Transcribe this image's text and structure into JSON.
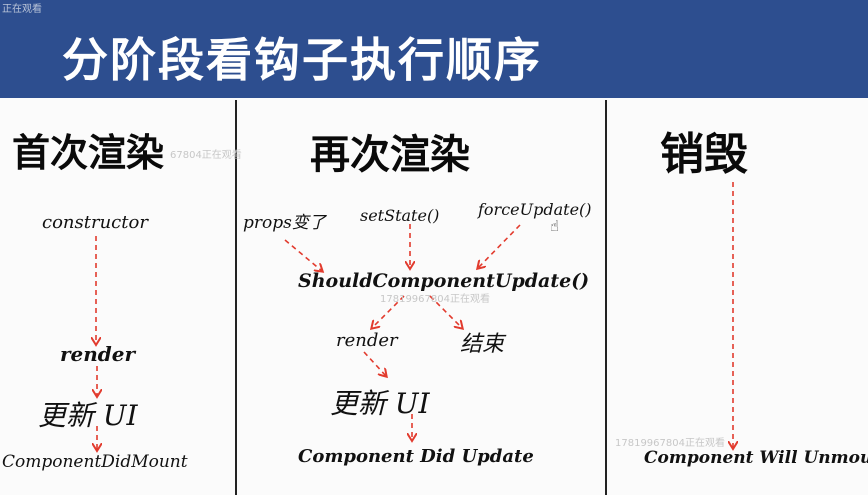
{
  "title": "分阶段看钩子执行顺序",
  "top_mark": "正在观看",
  "columns": {
    "first_render": {
      "heading": "首次渲染",
      "constructor": "constructor",
      "render": "render",
      "update_ui": "更新 UI",
      "did_mount": "ComponentDidMount"
    },
    "re_render": {
      "heading": "再次渲染",
      "props_change": "props变了",
      "set_state": "setState()",
      "force_update": "forceUpdate()",
      "should_update": "ShouldComponentUpdate()",
      "render": "render",
      "end": "结束",
      "update_ui": "更新 UI",
      "did_update": "Component Did Update"
    },
    "unmount": {
      "heading": "销毁",
      "will_unmount": "Component Will Unmount"
    }
  },
  "watermarks": {
    "w1": "67804正在观看",
    "w2": "17819967804正在观看",
    "w3": "17819967804正在观看"
  },
  "colors": {
    "title_bar": "#2d4e8f",
    "arrow": "#e23b2e"
  }
}
